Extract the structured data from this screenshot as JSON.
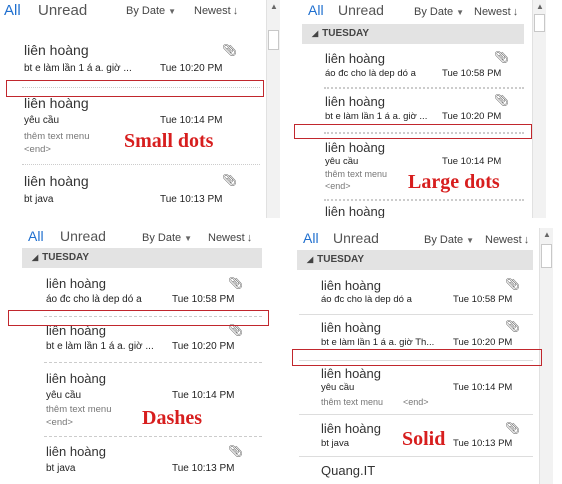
{
  "header": {
    "all": "All",
    "unread": "Unread",
    "by_date": "By Date",
    "newest": "Newest"
  },
  "section_label": "TUESDAY",
  "labels": {
    "small_dots": "Small dots",
    "large_dots": "Large dots",
    "dashes": "Dashes",
    "solid": "Solid"
  },
  "icons": {
    "attachment": "paperclip-icon",
    "sort_caret": "triangle-down-icon",
    "sort_arrow": "arrow-down-icon",
    "collapse": "triangle-down-icon",
    "scroll_up": "triangle-up-icon"
  },
  "colors": {
    "accent": "#1f6fcf",
    "label_red": "#d71e1e",
    "box_red": "#c1272d"
  },
  "panels": {
    "tl": {
      "items": [
        {
          "sender": "liên hoàng",
          "subject": "bt e làm lần 1 á a. giờ ...",
          "time": "Tue 10:20 PM",
          "preview": "",
          "end": ""
        },
        {
          "sender": "liên hoàng",
          "subject": "yêu cầu",
          "time": "Tue 10:14 PM",
          "preview": "thêm text menu",
          "end": "<end>"
        },
        {
          "sender": "liên hoàng",
          "subject": "bt java",
          "time": "Tue 10:13 PM",
          "preview": "",
          "end": ""
        }
      ]
    },
    "tr": {
      "items": [
        {
          "sender": "liên hoàng",
          "subject": "áo đc cho là dep dó a",
          "time": "Tue 10:58 PM"
        },
        {
          "sender": "liên hoàng",
          "subject": "bt e làm lần 1 á a. giờ ...",
          "time": "Tue 10:20 PM"
        },
        {
          "sender": "liên hoàng",
          "subject": "yêu cầu",
          "time": "Tue 10:14 PM",
          "preview": "thêm text menu",
          "end": "<end>"
        },
        {
          "sender": "liên hoàng"
        }
      ]
    },
    "bl": {
      "items": [
        {
          "sender": "liên hoàng",
          "subject": "áo đc cho là dep dó a",
          "time": "Tue 10:58 PM"
        },
        {
          "sender": "liên hoàng",
          "subject": "bt e làm lần 1 á a. giờ ...",
          "time": "Tue 10:20 PM"
        },
        {
          "sender": "liên hoàng",
          "subject": "yêu cầu",
          "time": "Tue 10:14 PM",
          "preview": "thêm text menu",
          "end": "<end>"
        },
        {
          "sender": "liên hoàng",
          "subject": "bt java",
          "time": "Tue 10:13 PM"
        }
      ]
    },
    "br": {
      "items": [
        {
          "sender": "liên hoàng",
          "subject": "áo đc cho là dep dó a",
          "time": "Tue 10:58 PM"
        },
        {
          "sender": "liên hoàng",
          "subject": "bt e làm lần 1 á a. giờ Th...",
          "time": "Tue 10:20 PM"
        },
        {
          "sender": "liên hoàng",
          "subject": "yêu cầu",
          "time": "Tue 10:14 PM",
          "preview": "thêm text menu",
          "end": "<end>"
        },
        {
          "sender": "liên hoàng",
          "subject": "bt java",
          "time": "Tue 10:13 PM"
        },
        {
          "sender": "Quang.IT"
        }
      ]
    }
  }
}
